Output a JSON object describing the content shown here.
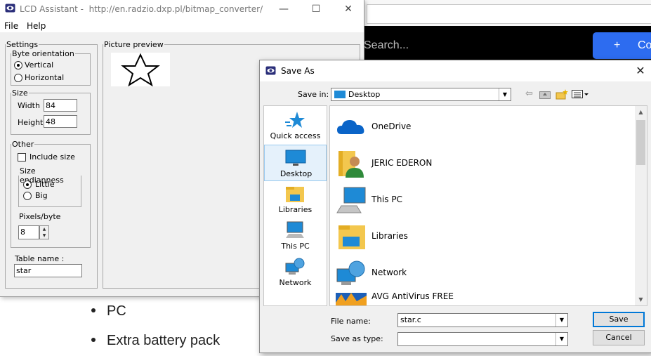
{
  "background_page": {
    "search_placeholder": "Search...",
    "create_button": {
      "icon": "plus-icon",
      "plus": "+",
      "label": "Co"
    },
    "list_items": [
      "PC",
      "Extra battery pack"
    ]
  },
  "lcd_window": {
    "title": "LCD Assistant -",
    "url": "http://en.radzio.dxp.pl/bitmap_converter/",
    "controls": {
      "minimize": "—",
      "maximize": "☐",
      "close": "✕"
    },
    "menu": [
      "File",
      "Help"
    ],
    "settings": {
      "legend": "Settings",
      "byte_orientation": {
        "legend": "Byte orientation",
        "options": [
          "Vertical",
          "Horizontal"
        ],
        "selected": "Vertical"
      },
      "size": {
        "legend": "Size",
        "width_label": "Width",
        "width_value": "84",
        "height_label": "Height",
        "height_value": "48"
      },
      "other": {
        "legend": "Other",
        "include_size_label": "Include size",
        "include_size_checked": false,
        "endianness": {
          "legend": "Size endianness",
          "options": [
            "Little",
            "Big"
          ],
          "selected": "Little"
        },
        "pixels_per_byte_label": "Pixels/byte",
        "pixels_per_byte_value": "8"
      },
      "table_name_label": "Table name :",
      "table_name_value": "star"
    },
    "preview": {
      "legend": "Picture preview",
      "image": "star-outline"
    }
  },
  "save_dialog": {
    "title": "Save As",
    "close": "✕",
    "save_in_label": "Save in:",
    "save_in_value": "Desktop",
    "toolbar_icons": [
      "back-icon",
      "up-folder-icon",
      "new-folder-icon",
      "view-menu-icon"
    ],
    "places": [
      {
        "label": "Quick access",
        "icon": "star-icon",
        "selected": false
      },
      {
        "label": "Desktop",
        "icon": "desktop-icon",
        "selected": true
      },
      {
        "label": "Libraries",
        "icon": "libraries-icon",
        "selected": false
      },
      {
        "label": "This PC",
        "icon": "computer-icon",
        "selected": false
      },
      {
        "label": "Network",
        "icon": "network-icon",
        "selected": false
      }
    ],
    "files": [
      {
        "name": "OneDrive",
        "icon": "cloud-icon"
      },
      {
        "name": "JERIC EDERON",
        "icon": "user-folder-icon"
      },
      {
        "name": "This PC",
        "icon": "computer-icon"
      },
      {
        "name": "Libraries",
        "icon": "libraries-icon"
      },
      {
        "name": "Network",
        "icon": "network-icon"
      },
      {
        "name": "AVG AntiVirus FREE",
        "icon": "avg-icon"
      }
    ],
    "file_name_label": "File name:",
    "file_name_value": "star.c",
    "save_as_type_label": "Save as type:",
    "save_as_type_value": "",
    "save_button": "Save",
    "cancel_button": "Cancel"
  },
  "colors": {
    "accent": "#2d6cf0",
    "selection": "#e5f1fb",
    "selection_border": "#99c9ef",
    "folder": "#f3c74e",
    "dialog_bg": "#f0f0f0"
  }
}
